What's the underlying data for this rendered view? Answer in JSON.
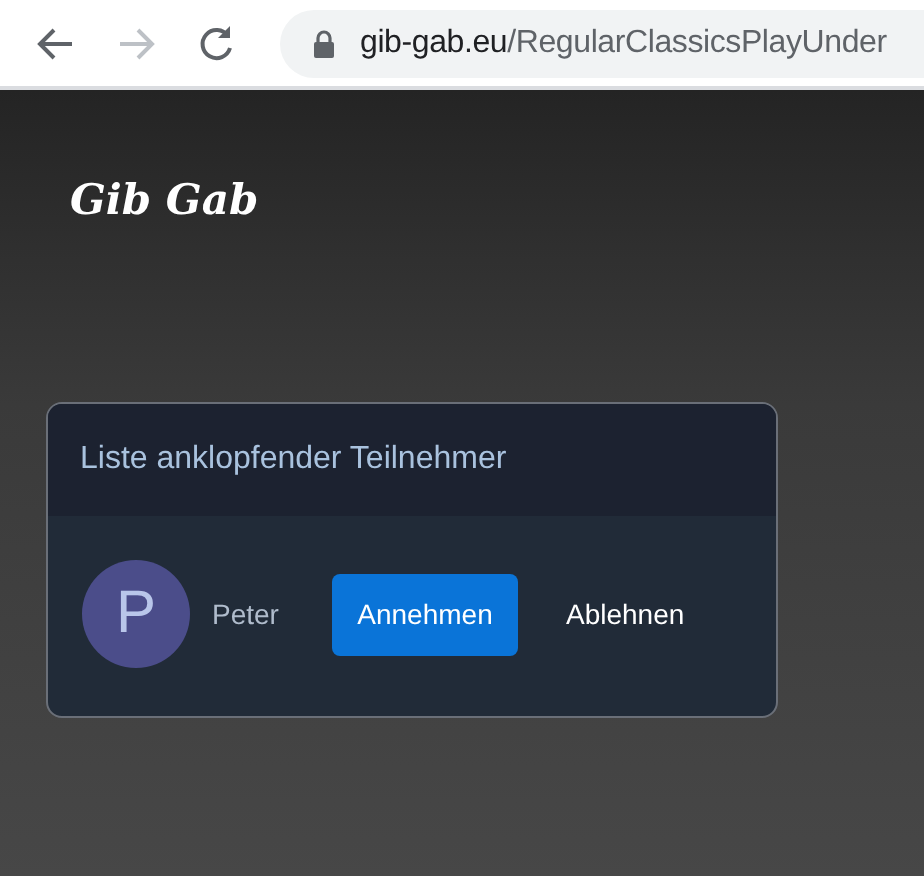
{
  "browser": {
    "url_host": "gib-gab.eu",
    "url_path": "/RegularClassicsPlayUnder"
  },
  "logo": "Gib Gab",
  "dialog": {
    "title": "Liste anklopfender Teilnehmer",
    "participants": [
      {
        "initial": "P",
        "name": "Peter",
        "accept": "Annehmen",
        "reject": "Ablehnen"
      }
    ]
  }
}
